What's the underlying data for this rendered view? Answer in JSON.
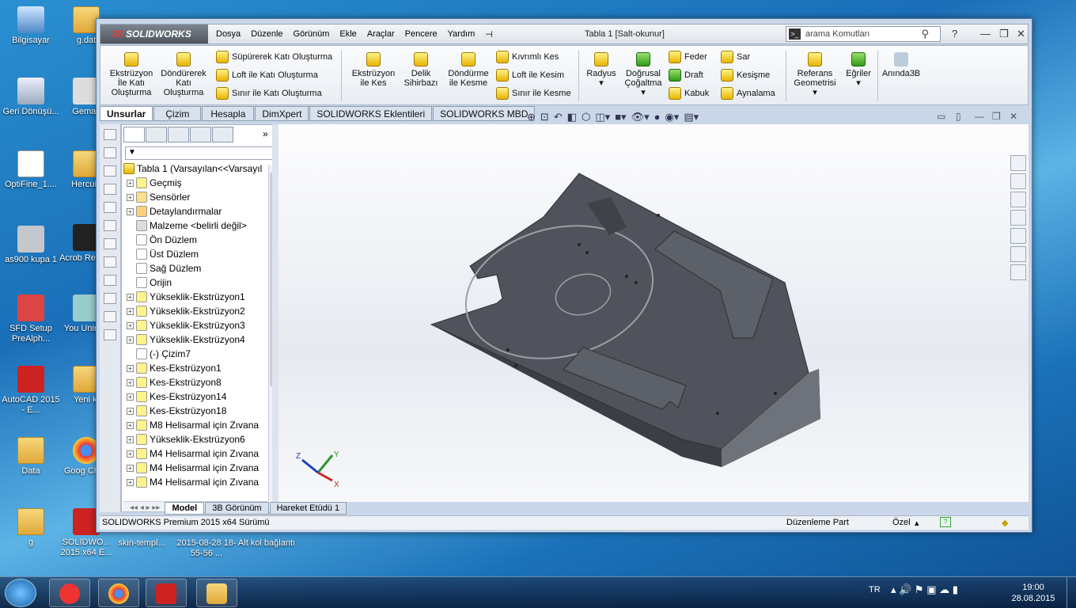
{
  "desktop": {
    "icons": [
      "Bilgisayar",
      "g.dat",
      "Geri Dönüşü...",
      "Gemas",
      "OptiFine_1....",
      "HercuLi",
      "as900 kupa 1",
      "Acrob Reader",
      "SFD Setup PreAlph...",
      "You Unin-st",
      "AutoCAD 2015 - E...",
      "Yeni kl",
      "Data",
      "Goog Chroi",
      "g",
      "SOLIDWO... 2015 x64 E...",
      "skin-templ...",
      "2015-08-28 18-55-56 ...",
      "Alt kol bağlantı"
    ]
  },
  "app": {
    "logo": "SOLIDWORKS",
    "menu": [
      "Dosya",
      "Düzenle",
      "Görünüm",
      "Ekle",
      "Araçlar",
      "Pencere",
      "Yardım"
    ],
    "doc_title": "Tabla 1 [Salt-okunur]",
    "search_placeholder": "arama Komutları",
    "ribbon": {
      "big": [
        "Ekstrüzyon İle Katı Oluşturma",
        "Döndürerek Katı Oluşturma",
        "Ekstrüzyon ile Kes",
        "Delik Sihirbazı",
        "Döndürme ile Kesme",
        "Radyus",
        "Doğrusal Çoğaltma",
        "Referans Geometrisi",
        "Eğriler",
        "Anında3B"
      ],
      "small": [
        "Süpürerek Katı Oluşturma",
        "Loft ile Katı Oluşturma",
        "Sınır ile Katı Oluşturma",
        "Kıvrımlı Kes",
        "Loft ile Kesim",
        "Sınır ile Kesme",
        "Feder",
        "Draft",
        "Kabuk",
        "Sar",
        "Kesişme",
        "Aynalama"
      ]
    },
    "tabs": [
      "Unsurlar",
      "Çizim",
      "Hesapla",
      "DimXpert",
      "SOLIDWORKS Eklentileri",
      "SOLIDWORKS MBD"
    ],
    "tree": {
      "root": "Tabla 1  (Varsayılan<<Varsayıl",
      "items": [
        "Geçmiş",
        "Sensörler",
        "Detaylandırmalar",
        "Malzeme <belirli değil>",
        "Ön Düzlem",
        "Üst Düzlem",
        "Sağ Düzlem",
        "Orijin",
        "Yükseklik-Ekstrüzyon1",
        "Yükseklik-Ekstrüzyon2",
        "Yükseklik-Ekstrüzyon3",
        "Yükseklik-Ekstrüzyon4",
        "(-) Çizim7",
        "Kes-Ekstrüzyon1",
        "Kes-Ekstrüzyon8",
        "Kes-Ekstrüzyon14",
        "Kes-Ekstrüzyon18",
        "M8 Helisarmal için Zıvana",
        "Yükseklik-Ekstrüzyon6",
        "M4 Helisarmal için Zıvana",
        "M4 Helisarmal için Zıvana",
        "M4 Helisarmal için Zıvana"
      ]
    },
    "bottom_tabs": [
      "Model",
      "3B Görünüm",
      "Hareket Etüdü 1"
    ],
    "status": {
      "left": "SOLIDWORKS Premium 2015 x64 Sürümü",
      "mode": "Düzenleme Part",
      "units": "Özel"
    },
    "triad": {
      "x": "X",
      "y": "Y",
      "z": "Z"
    }
  },
  "taskbar": {
    "lang": "TR",
    "time": "19:00",
    "date": "28.08.2015"
  },
  "colors": {
    "part": "#4a4d55",
    "part_top": "#5a5e66",
    "accent": "#1a6fb8"
  }
}
